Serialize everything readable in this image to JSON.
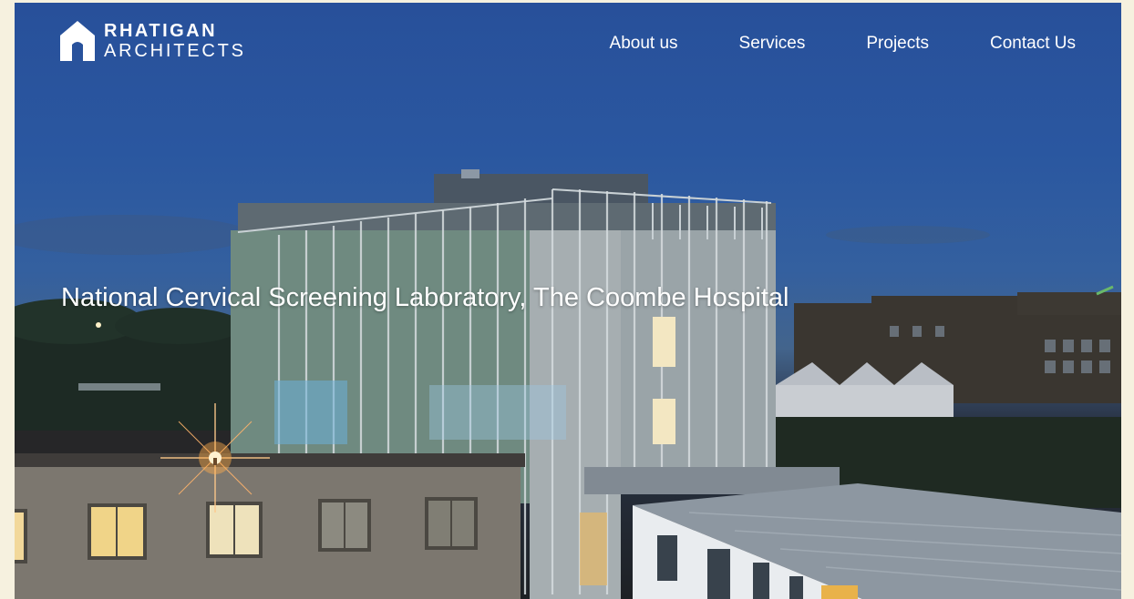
{
  "brand": {
    "name_line1": "RHATIGAN",
    "name_line2": "ARCHITECTS",
    "icon": "house-logo-icon"
  },
  "nav": {
    "items": [
      {
        "label": "About us"
      },
      {
        "label": "Services"
      },
      {
        "label": "Projects"
      },
      {
        "label": "Contact Us"
      }
    ]
  },
  "hero": {
    "title": "National Cervical Screening Laboratory, The Coombe Hospital",
    "image": "night-photo-of-laboratory-building"
  },
  "colors": {
    "page_background": "#f6f1df",
    "sky": "#2a57a0",
    "text": "#ffffff"
  }
}
